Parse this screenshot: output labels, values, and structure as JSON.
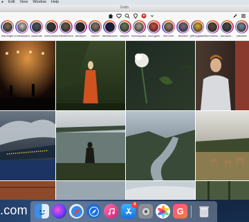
{
  "menubar": {
    "items": [
      "Edit",
      "View",
      "Window",
      "Help"
    ]
  },
  "window": {
    "title": "Grids"
  },
  "toolbar": {
    "icons": [
      "home-icon",
      "heart-icon",
      "search-icon",
      "location-pin-icon",
      "profile-icon",
      "chevron-down-icon"
    ],
    "right_icons": [
      "pen-icon",
      "list-icon"
    ]
  },
  "stories": [
    {
      "username": "learnsight",
      "color": "#7a6a5a"
    },
    {
      "username": "vmheadawns",
      "color": "#c9c3bd"
    },
    {
      "username": "vasamas",
      "color": "#4a5a6a"
    },
    {
      "username": "cmbenisina",
      "color": "#3a3a3a"
    },
    {
      "username": "infinitelovee",
      "color": "#6a5a4a"
    },
    {
      "username": "danalynn",
      "color": "#2a2a2a"
    },
    {
      "username": "markei",
      "color": "#8a7a6a"
    },
    {
      "username": "davidalvarez",
      "color": "#1a1a3a"
    },
    {
      "username": "sallylee",
      "color": "#6a7a5a"
    },
    {
      "username": "bombaysaul...",
      "color": "#b0a090"
    },
    {
      "username": "zhongwei",
      "color": "#d04a3a"
    },
    {
      "username": "mervnee",
      "color": "#a08070"
    },
    {
      "username": "lildolizei",
      "color": "#7a6a8a"
    },
    {
      "username": "jeffreyglaser",
      "color": "#e0b030"
    },
    {
      "username": "thereinesin...",
      "color": "#5a4a3a"
    },
    {
      "username": "damaslo...",
      "color": "#4a4a4a"
    },
    {
      "username": "clrbakes",
      "color": "#7a8a9a"
    }
  ],
  "dock": {
    "apps": [
      "finder-icon",
      "siri-icon",
      "safari-icon",
      "compass-icon",
      "itunes-icon",
      "app-store-icon",
      "system-preferences-icon",
      "photos-icon",
      "google-icon",
      "trash-icon"
    ],
    "app_store_badge": "4"
  },
  "wallpaper_text": ".com"
}
